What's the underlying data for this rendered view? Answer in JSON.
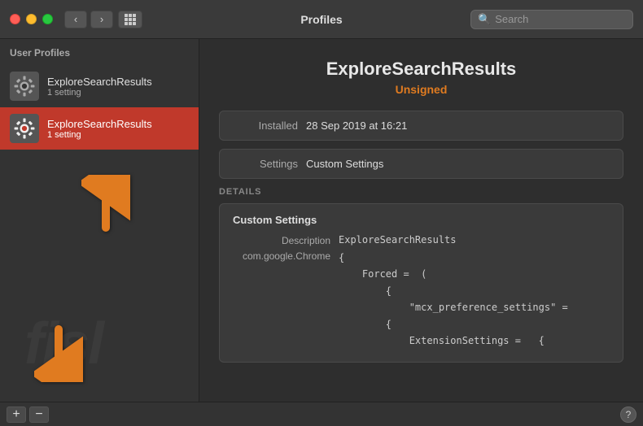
{
  "titlebar": {
    "title": "Profiles",
    "search_placeholder": "Search"
  },
  "sidebar": {
    "label": "User Profiles",
    "items": [
      {
        "name": "ExploreSearchResults",
        "sub": "1 setting",
        "selected": false
      },
      {
        "name": "ExploreSearchResults",
        "sub": "1 setting",
        "selected": true
      }
    ],
    "add_label": "+",
    "remove_label": "−"
  },
  "detail": {
    "title": "ExploreSearchResults",
    "status": "Unsigned",
    "installed_label": "Installed",
    "installed_value": "28 Sep 2019 at 16:21",
    "settings_label": "Settings",
    "settings_value": "Custom Settings",
    "details_label": "DETAILS",
    "custom_settings_title": "Custom Settings",
    "description_label": "Description",
    "description_value": "ExploreSearchResults",
    "chrome_label": "com.google.Chrome",
    "code_lines": [
      "{ ",
      "    Forced =  (",
      "        {",
      "            \"mcx_preference_settings\" =",
      "        {",
      "            ExtensionSettings =   {"
    ]
  },
  "help_label": "?"
}
